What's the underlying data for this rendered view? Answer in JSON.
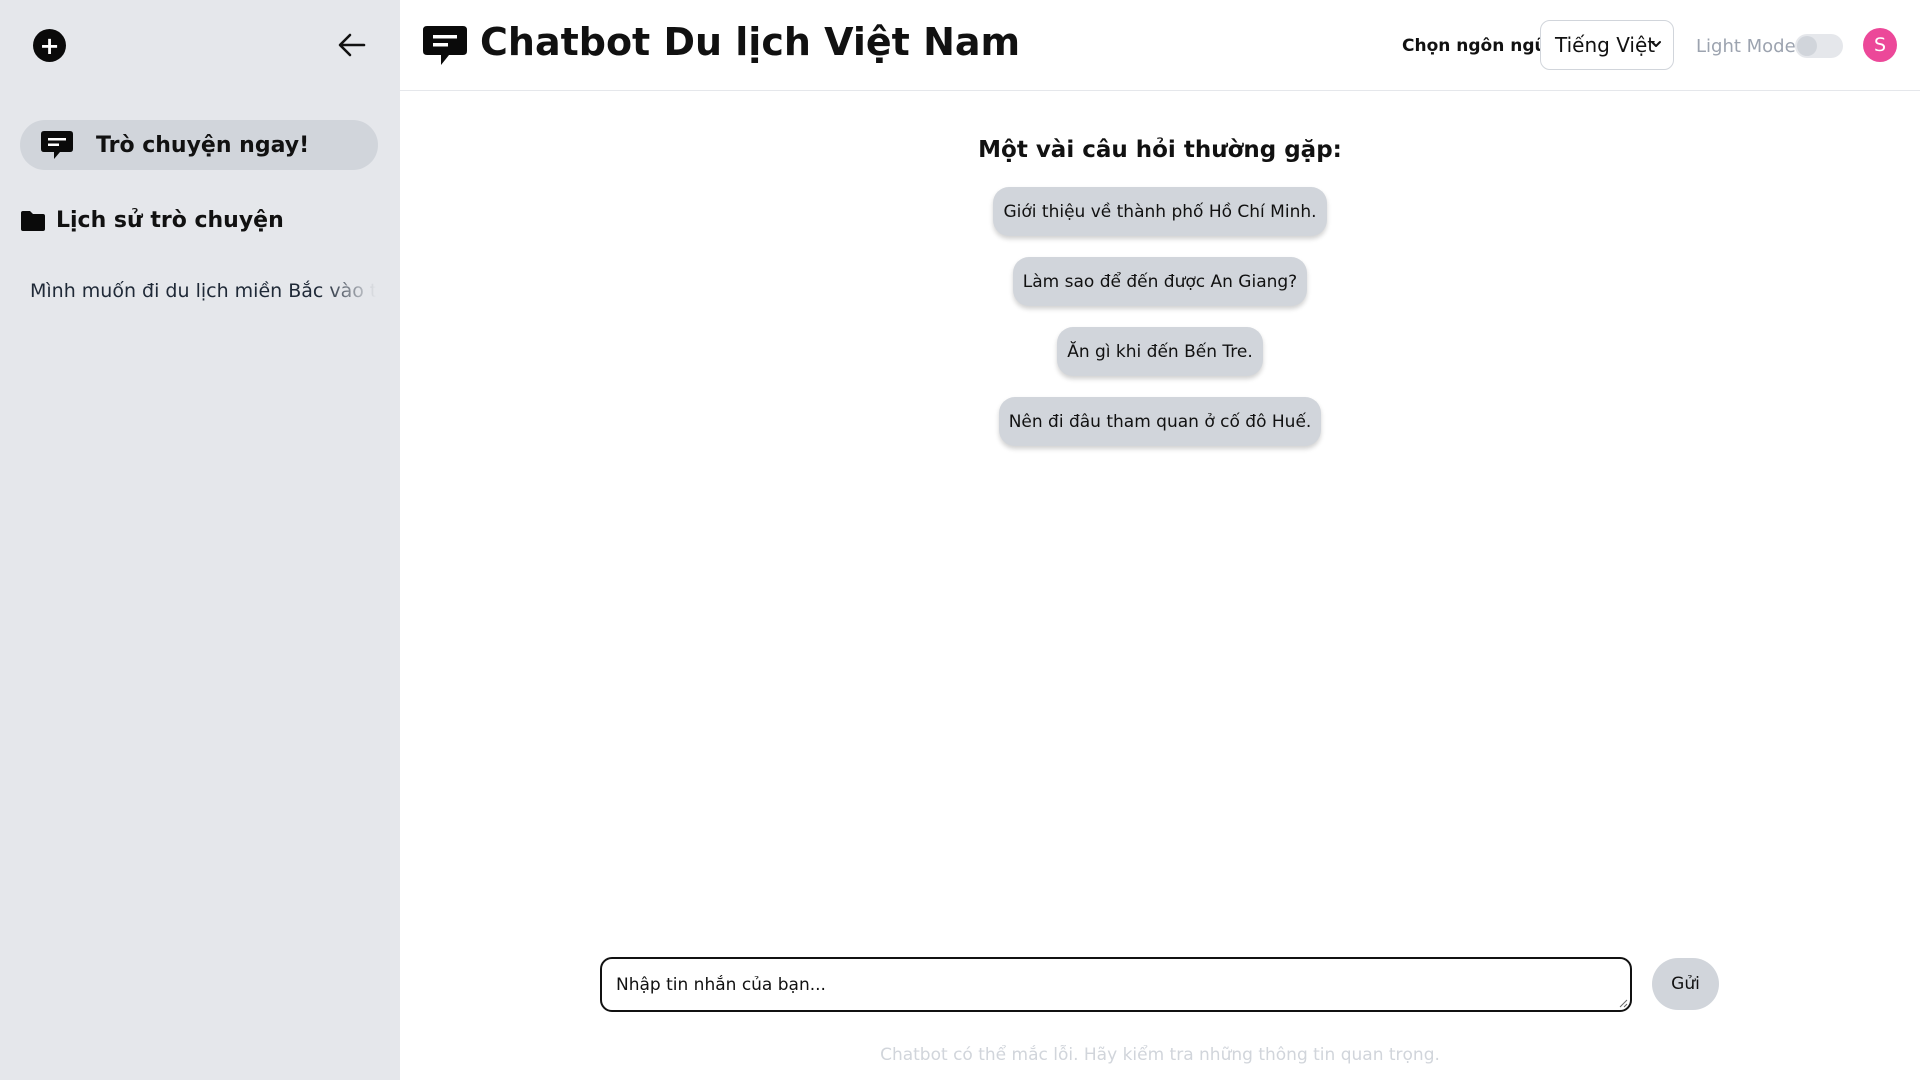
{
  "sidebar": {
    "new_chat_icon": "plus-circle-icon",
    "collapse_icon": "arrow-left-icon",
    "chat_now_label": "Trò chuyện ngay!",
    "history_title": "Lịch sử trò chuyện",
    "history_items": [
      "Mình muốn đi du lịch miền Bắc vào thá"
    ]
  },
  "header": {
    "title": "Chatbot Du lịch Việt Nam",
    "language_label": "Chọn ngôn ngữ:",
    "language_selected": "Tiếng Việt",
    "mode_label": "Light Mode",
    "avatar_initial": "S"
  },
  "main": {
    "faq_title": "Một vài câu hỏi thường gặp:",
    "faq": [
      "Giới thiệu về thành phố Hồ Chí Minh.",
      "Làm sao để đến được An Giang?",
      "Ăn gì khi đến Bến Tre.",
      "Nên đi đâu tham quan ở cố đô Huế."
    ],
    "input_placeholder": "Nhập tin nhắn của bạn...",
    "send_label": "Gửi",
    "disclaimer": "Chatbot có thể mắc lỗi. Hãy kiểm tra những thông tin quan trọng."
  },
  "colors": {
    "sidebar_bg": "#e5e7eb",
    "button_bg": "#d1d5db",
    "avatar_bg": "#ec4899",
    "text": "#111111"
  }
}
